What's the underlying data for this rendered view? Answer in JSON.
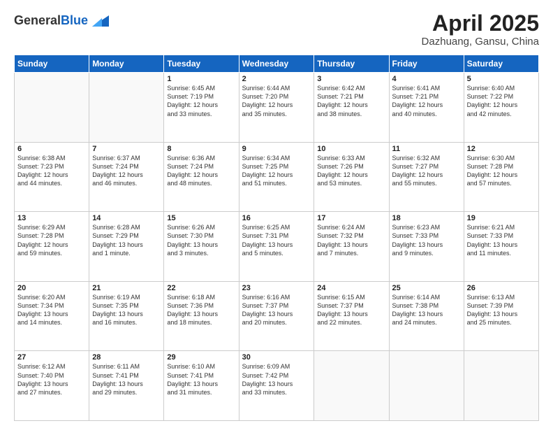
{
  "header": {
    "logo_general": "General",
    "logo_blue": "Blue",
    "month_title": "April 2025",
    "location": "Dazhuang, Gansu, China"
  },
  "weekdays": [
    "Sunday",
    "Monday",
    "Tuesday",
    "Wednesday",
    "Thursday",
    "Friday",
    "Saturday"
  ],
  "weeks": [
    [
      {
        "day": "",
        "info": ""
      },
      {
        "day": "",
        "info": ""
      },
      {
        "day": "1",
        "info": "Sunrise: 6:45 AM\nSunset: 7:19 PM\nDaylight: 12 hours\nand 33 minutes."
      },
      {
        "day": "2",
        "info": "Sunrise: 6:44 AM\nSunset: 7:20 PM\nDaylight: 12 hours\nand 35 minutes."
      },
      {
        "day": "3",
        "info": "Sunrise: 6:42 AM\nSunset: 7:21 PM\nDaylight: 12 hours\nand 38 minutes."
      },
      {
        "day": "4",
        "info": "Sunrise: 6:41 AM\nSunset: 7:21 PM\nDaylight: 12 hours\nand 40 minutes."
      },
      {
        "day": "5",
        "info": "Sunrise: 6:40 AM\nSunset: 7:22 PM\nDaylight: 12 hours\nand 42 minutes."
      }
    ],
    [
      {
        "day": "6",
        "info": "Sunrise: 6:38 AM\nSunset: 7:23 PM\nDaylight: 12 hours\nand 44 minutes."
      },
      {
        "day": "7",
        "info": "Sunrise: 6:37 AM\nSunset: 7:24 PM\nDaylight: 12 hours\nand 46 minutes."
      },
      {
        "day": "8",
        "info": "Sunrise: 6:36 AM\nSunset: 7:24 PM\nDaylight: 12 hours\nand 48 minutes."
      },
      {
        "day": "9",
        "info": "Sunrise: 6:34 AM\nSunset: 7:25 PM\nDaylight: 12 hours\nand 51 minutes."
      },
      {
        "day": "10",
        "info": "Sunrise: 6:33 AM\nSunset: 7:26 PM\nDaylight: 12 hours\nand 53 minutes."
      },
      {
        "day": "11",
        "info": "Sunrise: 6:32 AM\nSunset: 7:27 PM\nDaylight: 12 hours\nand 55 minutes."
      },
      {
        "day": "12",
        "info": "Sunrise: 6:30 AM\nSunset: 7:28 PM\nDaylight: 12 hours\nand 57 minutes."
      }
    ],
    [
      {
        "day": "13",
        "info": "Sunrise: 6:29 AM\nSunset: 7:28 PM\nDaylight: 12 hours\nand 59 minutes."
      },
      {
        "day": "14",
        "info": "Sunrise: 6:28 AM\nSunset: 7:29 PM\nDaylight: 13 hours\nand 1 minute."
      },
      {
        "day": "15",
        "info": "Sunrise: 6:26 AM\nSunset: 7:30 PM\nDaylight: 13 hours\nand 3 minutes."
      },
      {
        "day": "16",
        "info": "Sunrise: 6:25 AM\nSunset: 7:31 PM\nDaylight: 13 hours\nand 5 minutes."
      },
      {
        "day": "17",
        "info": "Sunrise: 6:24 AM\nSunset: 7:32 PM\nDaylight: 13 hours\nand 7 minutes."
      },
      {
        "day": "18",
        "info": "Sunrise: 6:23 AM\nSunset: 7:33 PM\nDaylight: 13 hours\nand 9 minutes."
      },
      {
        "day": "19",
        "info": "Sunrise: 6:21 AM\nSunset: 7:33 PM\nDaylight: 13 hours\nand 11 minutes."
      }
    ],
    [
      {
        "day": "20",
        "info": "Sunrise: 6:20 AM\nSunset: 7:34 PM\nDaylight: 13 hours\nand 14 minutes."
      },
      {
        "day": "21",
        "info": "Sunrise: 6:19 AM\nSunset: 7:35 PM\nDaylight: 13 hours\nand 16 minutes."
      },
      {
        "day": "22",
        "info": "Sunrise: 6:18 AM\nSunset: 7:36 PM\nDaylight: 13 hours\nand 18 minutes."
      },
      {
        "day": "23",
        "info": "Sunrise: 6:16 AM\nSunset: 7:37 PM\nDaylight: 13 hours\nand 20 minutes."
      },
      {
        "day": "24",
        "info": "Sunrise: 6:15 AM\nSunset: 7:37 PM\nDaylight: 13 hours\nand 22 minutes."
      },
      {
        "day": "25",
        "info": "Sunrise: 6:14 AM\nSunset: 7:38 PM\nDaylight: 13 hours\nand 24 minutes."
      },
      {
        "day": "26",
        "info": "Sunrise: 6:13 AM\nSunset: 7:39 PM\nDaylight: 13 hours\nand 25 minutes."
      }
    ],
    [
      {
        "day": "27",
        "info": "Sunrise: 6:12 AM\nSunset: 7:40 PM\nDaylight: 13 hours\nand 27 minutes."
      },
      {
        "day": "28",
        "info": "Sunrise: 6:11 AM\nSunset: 7:41 PM\nDaylight: 13 hours\nand 29 minutes."
      },
      {
        "day": "29",
        "info": "Sunrise: 6:10 AM\nSunset: 7:41 PM\nDaylight: 13 hours\nand 31 minutes."
      },
      {
        "day": "30",
        "info": "Sunrise: 6:09 AM\nSunset: 7:42 PM\nDaylight: 13 hours\nand 33 minutes."
      },
      {
        "day": "",
        "info": ""
      },
      {
        "day": "",
        "info": ""
      },
      {
        "day": "",
        "info": ""
      }
    ]
  ]
}
